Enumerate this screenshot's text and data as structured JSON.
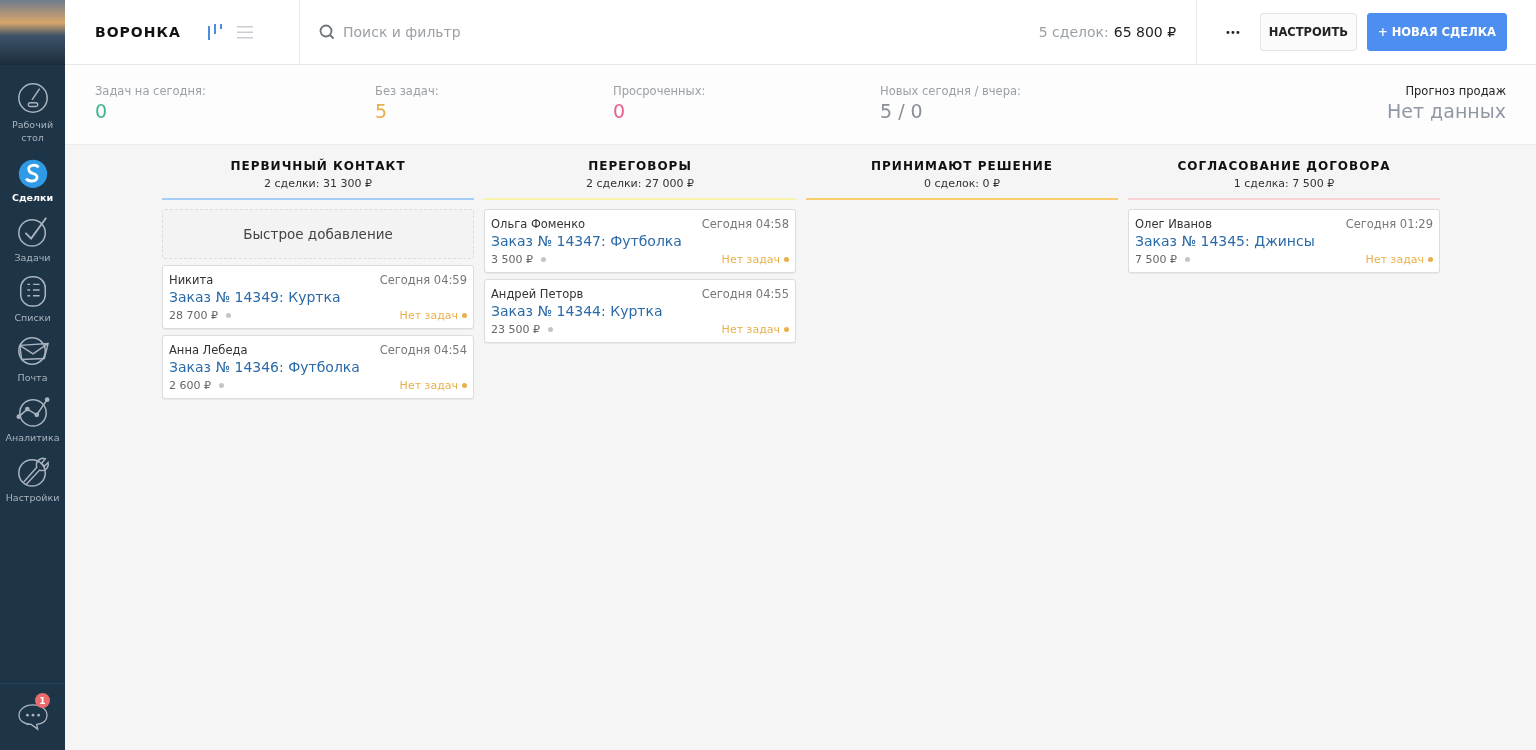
{
  "sidebar": {
    "items": [
      {
        "kind": "dashboard",
        "label": "Рабочий стол",
        "selected": false
      },
      {
        "kind": "deals",
        "label": "Сделки",
        "selected": true
      },
      {
        "kind": "tasks",
        "label": "Задачи",
        "selected": false
      },
      {
        "kind": "lists",
        "label": "Списки",
        "selected": false
      },
      {
        "kind": "mail",
        "label": "Почта",
        "selected": false
      },
      {
        "kind": "analytics",
        "label": "Аналитика",
        "selected": false
      },
      {
        "kind": "settings",
        "label": "Настройки",
        "selected": false
      }
    ],
    "chat": {
      "badge": "1"
    }
  },
  "header": {
    "title": "ВОРОНКА",
    "views": [
      {
        "kind": "pipeline",
        "selected": true
      },
      {
        "kind": "list",
        "selected": false
      }
    ],
    "search": {
      "placeholder": "Поиск и фильтр"
    },
    "summary_label": "5 сделок:",
    "summary_value": "65 800 ₽",
    "more": "•••",
    "buttons": [
      {
        "kind": "secondary",
        "label": "НАСТРОИТЬ"
      },
      {
        "kind": "primary",
        "label": "+ НОВАЯ СДЕЛКА"
      }
    ]
  },
  "stats": [
    {
      "label": "Задач на сегодня:",
      "value": "0",
      "color": "#3fb68a"
    },
    {
      "label": "Без задач:",
      "value": "5",
      "color": "#e8b04c"
    },
    {
      "label": "Просроченных:",
      "value": "0",
      "color": "#e8608c"
    },
    {
      "label": "Новых сегодня / вчера:",
      "value": "5 / 0",
      "color": "#8a9099"
    }
  ],
  "forecast": {
    "label": "Прогноз продаж",
    "value": "Нет данных"
  },
  "columns": [
    {
      "title": "ПЕРВИЧНЫЙ КОНТАКТ",
      "count": "2 сделки: 31 300 ₽",
      "color": "#a6cdf6",
      "quick_add": "Быстрое добавление",
      "cards": [
        {
          "contact": "Никита",
          "time": "Сегодня 04:59",
          "title": "Заказ № 14349: Куртка",
          "price": "28 700 ₽",
          "status": "Нет задач"
        },
        {
          "contact": "Анна Лебеда",
          "time": "Сегодня 04:54",
          "title": "Заказ № 14346: Футболка",
          "price": "2 600 ₽",
          "status": "Нет задач"
        }
      ]
    },
    {
      "title": "ПЕРЕГОВОРЫ",
      "count": "2 сделки: 27 000 ₽",
      "color": "#f7f2a6",
      "cards": [
        {
          "contact": "Ольга Фоменко",
          "time": "Сегодня 04:58",
          "title": "Заказ № 14347: Футболка",
          "price": "3 500 ₽",
          "status": "Нет задач"
        },
        {
          "contact": "Андрей Петорв",
          "time": "Сегодня 04:55",
          "title": "Заказ № 14344: Куртка",
          "price": "23 500 ₽",
          "status": "Нет задач"
        }
      ]
    },
    {
      "title": "ПРИНИМАЮТ РЕШЕНИЕ",
      "count": "0 сделок: 0 ₽",
      "color": "#f9cd6e"
    },
    {
      "title": "СОГЛАСОВАНИЕ ДОГОВОРА",
      "count": "1 сделка: 7 500 ₽",
      "color": "#f8d3d6",
      "cards": [
        {
          "contact": "Олег Иванов",
          "time": "Сегодня 01:29",
          "title": "Заказ № 14345: Джинсы",
          "price": "7 500 ₽",
          "status": "Нет задач"
        }
      ]
    }
  ]
}
